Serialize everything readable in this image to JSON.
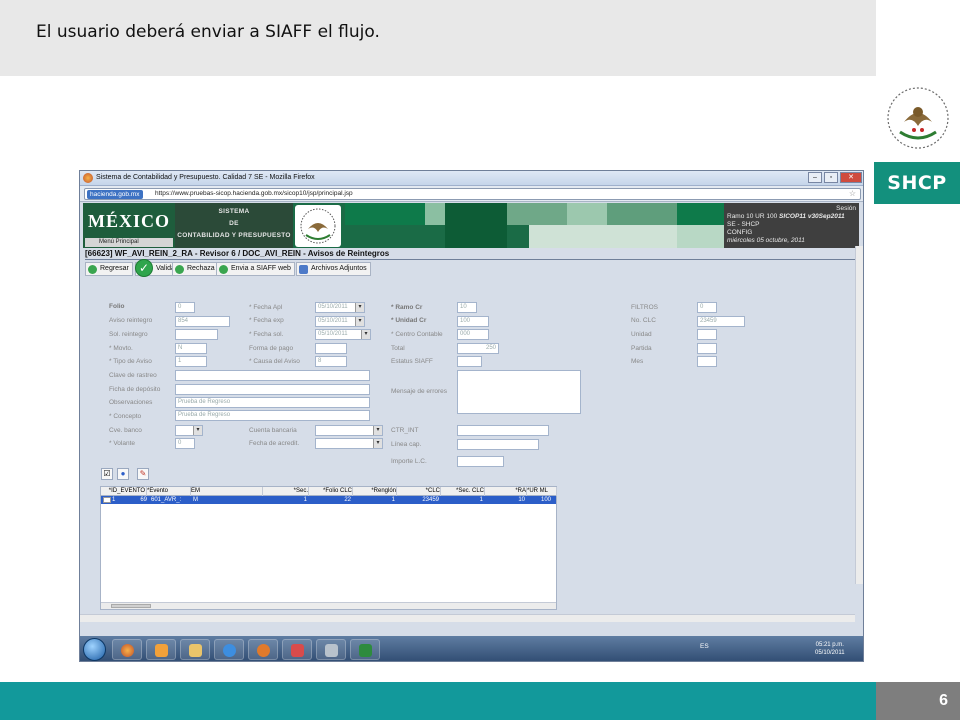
{
  "slide": {
    "title": "El usuario  deberá  enviar  a SIAFF el  flujo.",
    "brand": "SHCP",
    "page_number": "6",
    "colors": {
      "header_band": "#e8e8e8",
      "footer_band": "#12999b",
      "brand_green": "#13907d",
      "page_num_box": "#7e7e7e"
    }
  },
  "browser": {
    "window_title": "Sistema de Contabilidad y Presupuesto. Calidad 7 SE - Mozilla Firefox",
    "site_badge": "hacienda.gob.mx",
    "url": "https://www.pruebas-sicop.hacienda.gob.mx/sicop10/jsp/principal.jsp"
  },
  "banner": {
    "logo_text": "MÉXICO",
    "menu_principal": "Menú Principal",
    "sistema_lines": [
      "SISTEMA",
      "DE",
      "CONTABILIDAD Y PRESUPUESTO"
    ],
    "session": {
      "label": "Sesión",
      "line1": "Ramo  10  UR  100",
      "version": "SICOP11  v30Sep2011",
      "line2": "SE - SHCP",
      "line3": "CONFIG",
      "date": "miércoles 05 octubre, 2011"
    }
  },
  "breadcrumb": "[66623]  WF_AVI_REIN_2_RA - Revisor 6 / DOC_AVI_REIN - Avisos de Reintegros",
  "toolbar": {
    "regresar": "Regresar",
    "validar": "Validar",
    "rechaza": "Rechaza",
    "enviar_siaff": "Envia a SIAFF web",
    "archivos_adjuntos": "Archivos Adjuntos"
  },
  "form": {
    "col1": {
      "folio_label": "Folio",
      "folio_value": "0",
      "aviso_label": "Aviso reintegro",
      "aviso_value": "854",
      "sol_label": "Sol. reintegro",
      "sol_value": "",
      "movto_label": "* Movto.",
      "movto_value": "N",
      "tipo_label": "* Tipo de Aviso",
      "tipo_value": "1",
      "clave_label": "Clave de rastreo",
      "clave_value": "",
      "ficha_label": "Ficha de depósito",
      "ficha_value": "",
      "obs_label": "Observaciones",
      "obs_value": "Prueba de Regreso",
      "concepto_label": "* Concepto",
      "concepto_value": "Prueba de Regreso",
      "cve_banco_label": "Cve. banco",
      "cve_banco_value": "",
      "volante_label": "* Volante",
      "volante_value": "0"
    },
    "col2": {
      "fecha_apl_label": "* Fecha Apl",
      "fecha_apl_value": "05/10/2011",
      "fecha_exp_label": "* Fecha exp",
      "fecha_exp_value": "05/10/2011",
      "fecha_sol_label": "* Fecha sol.",
      "fecha_sol_value": "05/10/2011",
      "forma_pago_label": "Forma de pago",
      "forma_pago_value": "",
      "causa_label": "* Causa del Aviso",
      "causa_value": "8",
      "cuenta_label": "Cuenta bancaria",
      "cuenta_value": "",
      "fecha_acredit_label": "Fecha de acredit.",
      "fecha_acredit_value": ""
    },
    "col3": {
      "ramo_label": "* Ramo Cr",
      "ramo_value": "10",
      "unidad_label": "* Unidad Cr",
      "unidad_value": "100",
      "centro_label": "* Centro Contable",
      "centro_value": "000",
      "total_label": "Total",
      "total_value": "250",
      "estatus_label": "Estatus SIAFF",
      "estatus_value": "",
      "mensaje_label": "Mensaje de errores",
      "ctr_label": "CTR_INT",
      "linea_label": "Línea cap.",
      "importe_label": "Importe L.C."
    },
    "col4": {
      "filtros_label": "FILTROS",
      "filtros_value": "0",
      "clc_label": "No. CLC",
      "clc_value": "23459",
      "unidad_label": "Unidad",
      "partida_label": "Partida",
      "mes_label": "Mes"
    }
  },
  "grid": {
    "headers": [
      "*ID_EVENTO",
      "*Evento",
      "EM",
      "*Sec.",
      "*Folio CLC",
      "*Renglón",
      "*CLC",
      "*Sec. CLC",
      "*RA",
      "*UR ML"
    ],
    "row": {
      "id": "1",
      "id_evento": "69",
      "evento": "601_AVR_:",
      "em": "M",
      "sec": "1",
      "folio_clc": "22",
      "renglon": "1",
      "clc": "23459",
      "sec_clc": "1",
      "ra": "10",
      "ur_ml": "100"
    }
  },
  "taskbar": {
    "lang": "ES",
    "time": "05:21 p.m.",
    "date": "05/10/2011"
  }
}
